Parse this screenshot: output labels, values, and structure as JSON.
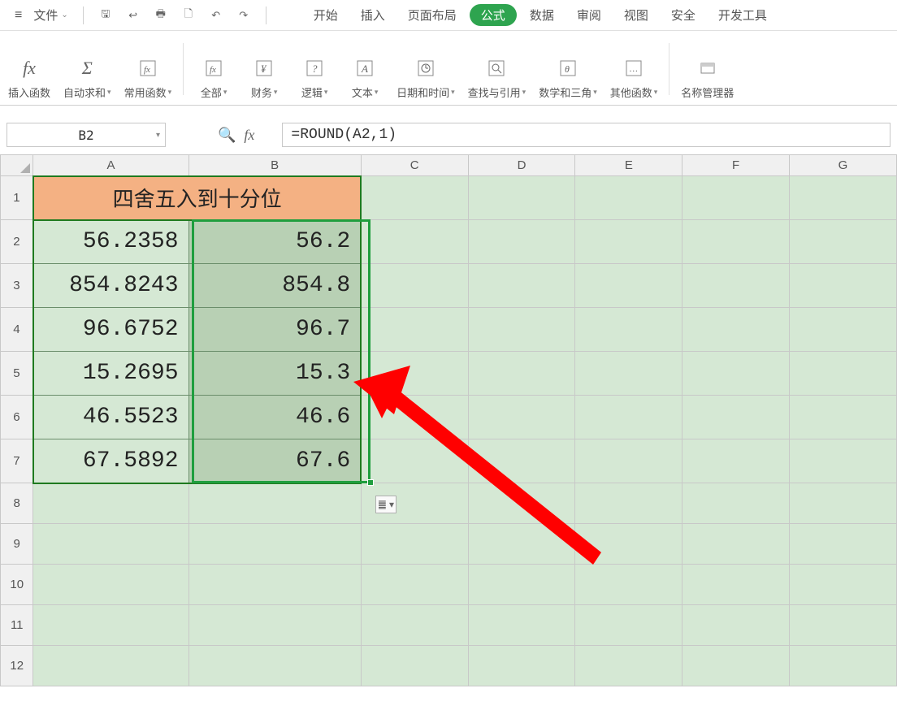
{
  "menubar": {
    "file_label": "文件",
    "tabs": [
      "开始",
      "插入",
      "页面布局",
      "公式",
      "数据",
      "审阅",
      "视图",
      "安全",
      "开发工具"
    ],
    "active_tab_index": 3
  },
  "ribbon": {
    "items": [
      {
        "icon": "fx",
        "label": "插入函数",
        "dd": false
      },
      {
        "icon": "Σ",
        "label": "自动求和",
        "dd": true
      },
      {
        "icon": "fx★",
        "label": "常用函数",
        "dd": true
      },
      {
        "icon": "fx□",
        "label": "全部",
        "dd": true
      },
      {
        "icon": "¥",
        "label": "财务",
        "dd": true
      },
      {
        "icon": "?",
        "label": "逻辑",
        "dd": true
      },
      {
        "icon": "A",
        "label": "文本",
        "dd": true
      },
      {
        "icon": "⊙",
        "label": "日期和时间",
        "dd": true
      },
      {
        "icon": "Q",
        "label": "查找与引用",
        "dd": true
      },
      {
        "icon": "θ",
        "label": "数学和三角",
        "dd": true
      },
      {
        "icon": "…",
        "label": "其他函数",
        "dd": true
      },
      {
        "icon": "▭",
        "label": "名称管理器",
        "dd": false
      }
    ]
  },
  "formula_bar": {
    "name_box": "B2",
    "formula": "=ROUND(A2,1)"
  },
  "columns": [
    "A",
    "B",
    "C",
    "D",
    "E",
    "F",
    "G"
  ],
  "rows": [
    1,
    2,
    3,
    4,
    5,
    6,
    7,
    8,
    9,
    10,
    11,
    12
  ],
  "sheet": {
    "title": "四舍五入到十分位",
    "data": [
      {
        "a": "56.2358",
        "b": "56.2"
      },
      {
        "a": "854.8243",
        "b": "854.8"
      },
      {
        "a": "96.6752",
        "b": "96.7"
      },
      {
        "a": "15.2695",
        "b": "15.3"
      },
      {
        "a": "46.5523",
        "b": "46.6"
      },
      {
        "a": "67.5892",
        "b": "67.6"
      }
    ]
  },
  "paste_options_icon": "䷀ ▾"
}
